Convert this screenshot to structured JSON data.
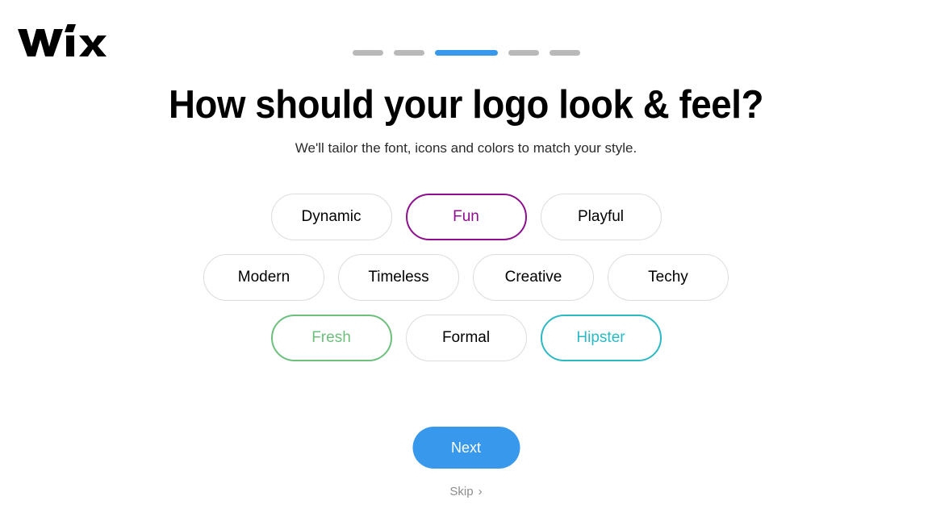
{
  "brand": {
    "name": "Wix",
    "logo_color": "#000000"
  },
  "progress": {
    "total_steps": 5,
    "active_step": 3,
    "active_color": "#3899ec",
    "inactive_color": "#b9b9b9",
    "steps": [
      {
        "state": "inactive"
      },
      {
        "state": "inactive"
      },
      {
        "state": "active"
      },
      {
        "state": "inactive"
      },
      {
        "state": "inactive"
      }
    ]
  },
  "header": {
    "title": "How should your logo look & feel?",
    "subtitle": "We'll tailor the font, icons and colors to match your style."
  },
  "styles": {
    "rows": [
      [
        {
          "label": "Dynamic",
          "selected": false,
          "color": "#000000"
        },
        {
          "label": "Fun",
          "selected": true,
          "color": "#8d0f8d"
        },
        {
          "label": "Playful",
          "selected": false,
          "color": "#000000"
        }
      ],
      [
        {
          "label": "Modern",
          "selected": false,
          "color": "#000000"
        },
        {
          "label": "Timeless",
          "selected": false,
          "color": "#000000"
        },
        {
          "label": "Creative",
          "selected": false,
          "color": "#000000"
        },
        {
          "label": "Techy",
          "selected": false,
          "color": "#000000"
        }
      ],
      [
        {
          "label": "Fresh",
          "selected": true,
          "color": "#6cc07c"
        },
        {
          "label": "Formal",
          "selected": false,
          "color": "#000000"
        },
        {
          "label": "Hipster",
          "selected": true,
          "color": "#2cb9c4"
        }
      ]
    ],
    "unselected_border_color": "#dcdcdc"
  },
  "footer": {
    "next_label": "Next",
    "next_color": "#3899ec",
    "skip_label": "Skip",
    "skip_icon": "chevron-right-icon"
  }
}
